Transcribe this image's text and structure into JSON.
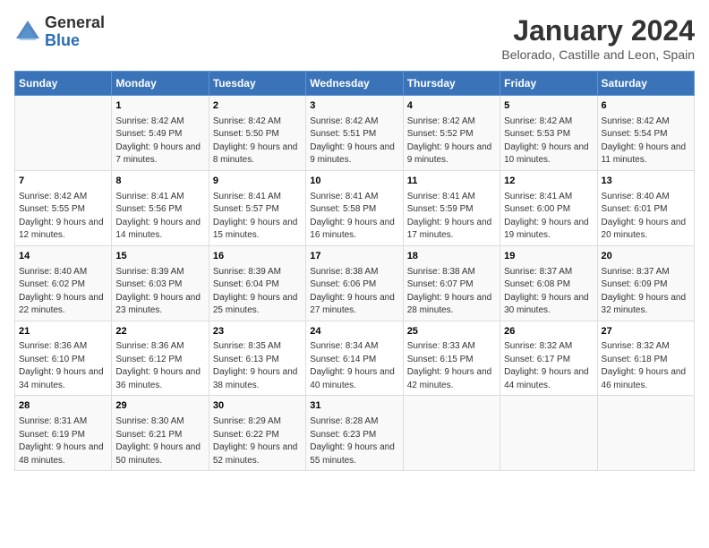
{
  "logo": {
    "general": "General",
    "blue": "Blue"
  },
  "title": "January 2024",
  "subtitle": "Belorado, Castille and Leon, Spain",
  "days_header": [
    "Sunday",
    "Monday",
    "Tuesday",
    "Wednesday",
    "Thursday",
    "Friday",
    "Saturday"
  ],
  "weeks": [
    [
      {
        "num": "",
        "sunrise": "",
        "sunset": "",
        "daylight": ""
      },
      {
        "num": "1",
        "sunrise": "Sunrise: 8:42 AM",
        "sunset": "Sunset: 5:49 PM",
        "daylight": "Daylight: 9 hours and 7 minutes."
      },
      {
        "num": "2",
        "sunrise": "Sunrise: 8:42 AM",
        "sunset": "Sunset: 5:50 PM",
        "daylight": "Daylight: 9 hours and 8 minutes."
      },
      {
        "num": "3",
        "sunrise": "Sunrise: 8:42 AM",
        "sunset": "Sunset: 5:51 PM",
        "daylight": "Daylight: 9 hours and 9 minutes."
      },
      {
        "num": "4",
        "sunrise": "Sunrise: 8:42 AM",
        "sunset": "Sunset: 5:52 PM",
        "daylight": "Daylight: 9 hours and 9 minutes."
      },
      {
        "num": "5",
        "sunrise": "Sunrise: 8:42 AM",
        "sunset": "Sunset: 5:53 PM",
        "daylight": "Daylight: 9 hours and 10 minutes."
      },
      {
        "num": "6",
        "sunrise": "Sunrise: 8:42 AM",
        "sunset": "Sunset: 5:54 PM",
        "daylight": "Daylight: 9 hours and 11 minutes."
      }
    ],
    [
      {
        "num": "7",
        "sunrise": "Sunrise: 8:42 AM",
        "sunset": "Sunset: 5:55 PM",
        "daylight": "Daylight: 9 hours and 12 minutes."
      },
      {
        "num": "8",
        "sunrise": "Sunrise: 8:41 AM",
        "sunset": "Sunset: 5:56 PM",
        "daylight": "Daylight: 9 hours and 14 minutes."
      },
      {
        "num": "9",
        "sunrise": "Sunrise: 8:41 AM",
        "sunset": "Sunset: 5:57 PM",
        "daylight": "Daylight: 9 hours and 15 minutes."
      },
      {
        "num": "10",
        "sunrise": "Sunrise: 8:41 AM",
        "sunset": "Sunset: 5:58 PM",
        "daylight": "Daylight: 9 hours and 16 minutes."
      },
      {
        "num": "11",
        "sunrise": "Sunrise: 8:41 AM",
        "sunset": "Sunset: 5:59 PM",
        "daylight": "Daylight: 9 hours and 17 minutes."
      },
      {
        "num": "12",
        "sunrise": "Sunrise: 8:41 AM",
        "sunset": "Sunset: 6:00 PM",
        "daylight": "Daylight: 9 hours and 19 minutes."
      },
      {
        "num": "13",
        "sunrise": "Sunrise: 8:40 AM",
        "sunset": "Sunset: 6:01 PM",
        "daylight": "Daylight: 9 hours and 20 minutes."
      }
    ],
    [
      {
        "num": "14",
        "sunrise": "Sunrise: 8:40 AM",
        "sunset": "Sunset: 6:02 PM",
        "daylight": "Daylight: 9 hours and 22 minutes."
      },
      {
        "num": "15",
        "sunrise": "Sunrise: 8:39 AM",
        "sunset": "Sunset: 6:03 PM",
        "daylight": "Daylight: 9 hours and 23 minutes."
      },
      {
        "num": "16",
        "sunrise": "Sunrise: 8:39 AM",
        "sunset": "Sunset: 6:04 PM",
        "daylight": "Daylight: 9 hours and 25 minutes."
      },
      {
        "num": "17",
        "sunrise": "Sunrise: 8:38 AM",
        "sunset": "Sunset: 6:06 PM",
        "daylight": "Daylight: 9 hours and 27 minutes."
      },
      {
        "num": "18",
        "sunrise": "Sunrise: 8:38 AM",
        "sunset": "Sunset: 6:07 PM",
        "daylight": "Daylight: 9 hours and 28 minutes."
      },
      {
        "num": "19",
        "sunrise": "Sunrise: 8:37 AM",
        "sunset": "Sunset: 6:08 PM",
        "daylight": "Daylight: 9 hours and 30 minutes."
      },
      {
        "num": "20",
        "sunrise": "Sunrise: 8:37 AM",
        "sunset": "Sunset: 6:09 PM",
        "daylight": "Daylight: 9 hours and 32 minutes."
      }
    ],
    [
      {
        "num": "21",
        "sunrise": "Sunrise: 8:36 AM",
        "sunset": "Sunset: 6:10 PM",
        "daylight": "Daylight: 9 hours and 34 minutes."
      },
      {
        "num": "22",
        "sunrise": "Sunrise: 8:36 AM",
        "sunset": "Sunset: 6:12 PM",
        "daylight": "Daylight: 9 hours and 36 minutes."
      },
      {
        "num": "23",
        "sunrise": "Sunrise: 8:35 AM",
        "sunset": "Sunset: 6:13 PM",
        "daylight": "Daylight: 9 hours and 38 minutes."
      },
      {
        "num": "24",
        "sunrise": "Sunrise: 8:34 AM",
        "sunset": "Sunset: 6:14 PM",
        "daylight": "Daylight: 9 hours and 40 minutes."
      },
      {
        "num": "25",
        "sunrise": "Sunrise: 8:33 AM",
        "sunset": "Sunset: 6:15 PM",
        "daylight": "Daylight: 9 hours and 42 minutes."
      },
      {
        "num": "26",
        "sunrise": "Sunrise: 8:32 AM",
        "sunset": "Sunset: 6:17 PM",
        "daylight": "Daylight: 9 hours and 44 minutes."
      },
      {
        "num": "27",
        "sunrise": "Sunrise: 8:32 AM",
        "sunset": "Sunset: 6:18 PM",
        "daylight": "Daylight: 9 hours and 46 minutes."
      }
    ],
    [
      {
        "num": "28",
        "sunrise": "Sunrise: 8:31 AM",
        "sunset": "Sunset: 6:19 PM",
        "daylight": "Daylight: 9 hours and 48 minutes."
      },
      {
        "num": "29",
        "sunrise": "Sunrise: 8:30 AM",
        "sunset": "Sunset: 6:21 PM",
        "daylight": "Daylight: 9 hours and 50 minutes."
      },
      {
        "num": "30",
        "sunrise": "Sunrise: 8:29 AM",
        "sunset": "Sunset: 6:22 PM",
        "daylight": "Daylight: 9 hours and 52 minutes."
      },
      {
        "num": "31",
        "sunrise": "Sunrise: 8:28 AM",
        "sunset": "Sunset: 6:23 PM",
        "daylight": "Daylight: 9 hours and 55 minutes."
      },
      {
        "num": "",
        "sunrise": "",
        "sunset": "",
        "daylight": ""
      },
      {
        "num": "",
        "sunrise": "",
        "sunset": "",
        "daylight": ""
      },
      {
        "num": "",
        "sunrise": "",
        "sunset": "",
        "daylight": ""
      }
    ]
  ]
}
